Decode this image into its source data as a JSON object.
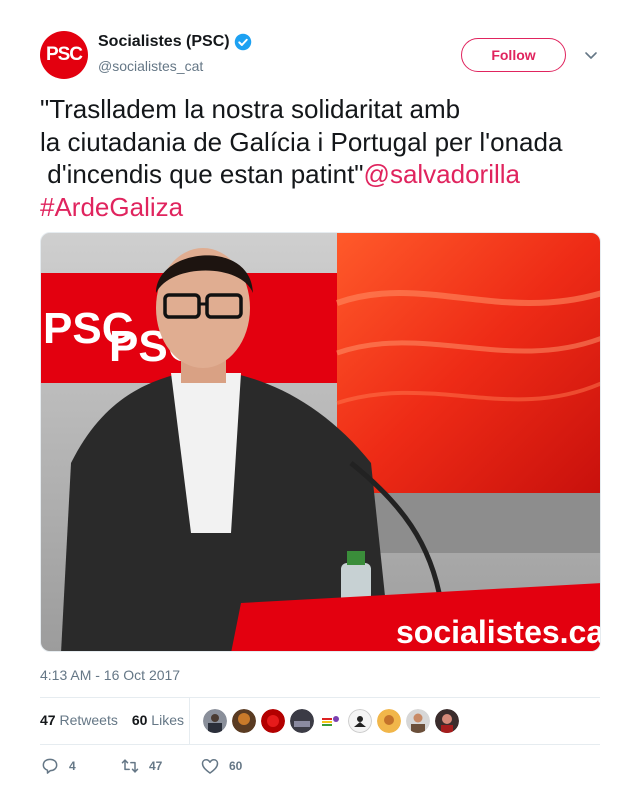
{
  "user": {
    "name": "Socialistes (PSC)",
    "handle": "@socialistes_cat",
    "avatar_text": "PSC"
  },
  "follow_label": "Follow",
  "tweet": {
    "text_line1": "\"Traslladem la nostra solidaritat amb",
    "text_line2": "la ciutadania de Galícia i Portugal per l'onada",
    "text_line3": " d'incendis que estan patint\"",
    "mention": "@salvadorilla",
    "hashtag": "#ArdeGaliza"
  },
  "photo": {
    "backdrop_logo_1": "PSC",
    "backdrop_logo_2": "PSC",
    "podium_text": "socialistes.cat"
  },
  "timestamp": "4:13 AM - 16 Oct 2017",
  "stats": {
    "retweets_count": "47",
    "retweets_label": "Retweets",
    "likes_count": "60",
    "likes_label": "Likes"
  },
  "actions": {
    "reply_count": "4",
    "retweet_count": "47",
    "like_count": "60"
  },
  "colors": {
    "accent": "#e0245e",
    "brand_red": "#e3000f",
    "verified": "#1da1f2"
  }
}
